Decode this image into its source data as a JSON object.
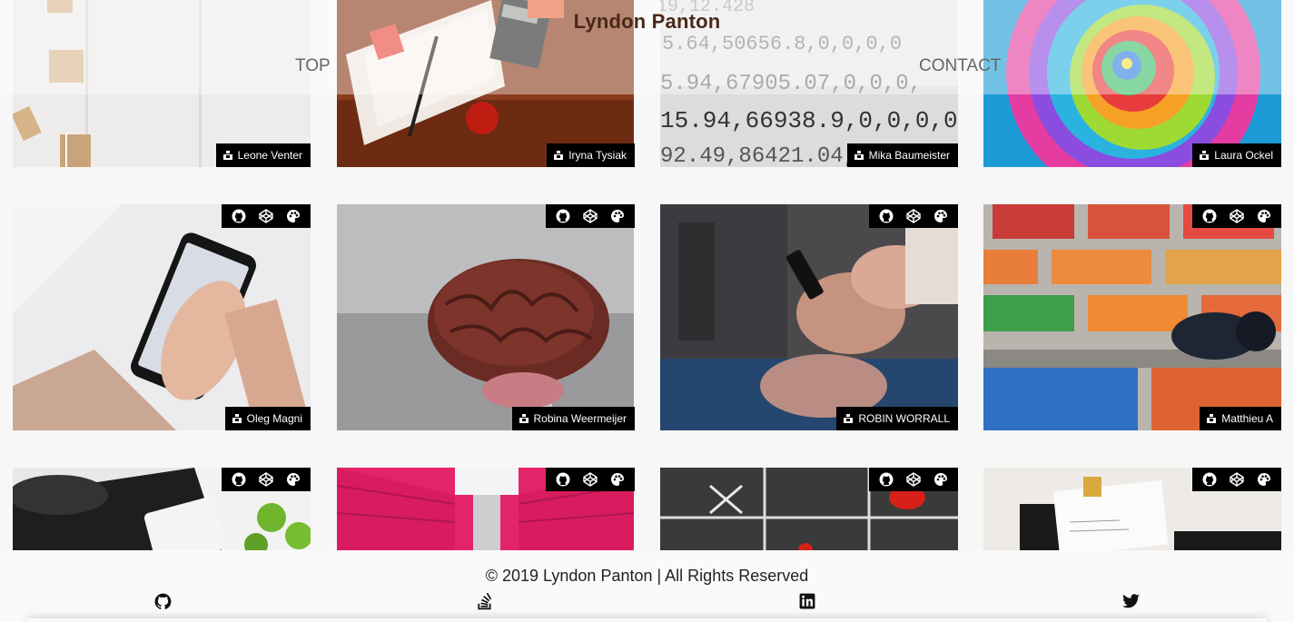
{
  "header": {
    "brand": "Lyndon Panton",
    "nav_top": "TOP",
    "nav_contact": "CONTACT"
  },
  "cards": [
    {
      "credit": "Leone Venter",
      "photo": "wooden-blocks-and-boxes",
      "tools": false
    },
    {
      "credit": "Iryna Tysiak",
      "photo": "planner-calculator-apple",
      "tools": false
    },
    {
      "credit": "Mika Baumeister",
      "photo": "printed-numbers-closeup",
      "tools": false
    },
    {
      "credit": "Laura Ockel",
      "photo": "rainbow-rose",
      "tools": false
    },
    {
      "credit": "Oleg Magni",
      "photo": "hand-holding-smartphone",
      "tools": true
    },
    {
      "credit": "Robina Weermeijer",
      "photo": "brain-model",
      "tools": true
    },
    {
      "credit": "ROBIN WORRALL",
      "photo": "people-using-phones",
      "tools": true
    },
    {
      "credit": "Matthieu A",
      "photo": "headphones-on-colored-bricks",
      "tools": true
    },
    {
      "credit": "",
      "photo": "kitchen-tablet-limes",
      "tools": true
    },
    {
      "credit": "",
      "photo": "red-storage-corridor",
      "tools": true
    },
    {
      "credit": "",
      "photo": "chalk-tic-tac-toe",
      "tools": true
    },
    {
      "credit": "",
      "photo": "notes-with-binder-clip",
      "tools": true
    }
  ],
  "card_tools": [
    "github-icon",
    "codepen-icon",
    "palette-icon"
  ],
  "footer": {
    "copyright": "© 2019 Lyndon Panton | All Rights Reserved",
    "socials": [
      "github-icon",
      "stack-overflow-icon",
      "linkedin-icon",
      "twitter-icon"
    ]
  },
  "colors": {
    "brand_text": "#4a2818",
    "credit_bg": "#000000",
    "page_bg": "#f7f7f7"
  }
}
